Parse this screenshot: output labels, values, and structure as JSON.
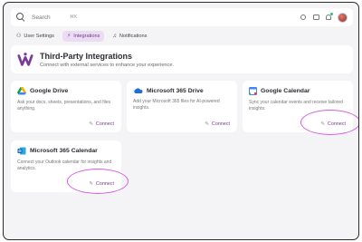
{
  "search": {
    "placeholder": "Search",
    "shortcut": "⌘K"
  },
  "tabs": [
    {
      "label": "User Settings"
    },
    {
      "label": "Integrations"
    },
    {
      "label": "Notifications"
    }
  ],
  "header": {
    "title": "Third-Party Integrations",
    "subtitle": "Connect with external services to enhance your experience."
  },
  "cards": [
    {
      "title": "Google Drive",
      "description": "Ask your docs, sheets, presentations, and files anything.",
      "button": "Connect"
    },
    {
      "title": "Microsoft 365 Drive",
      "description": "Add your Microsoft 365 files for AI-powered insights.",
      "button": "Connect"
    },
    {
      "title": "Google Calendar",
      "description": "Sync your calendar events and receive tailored insights.",
      "button": "Connect"
    },
    {
      "title": "Microsoft 365 Calendar",
      "description": "Connect your Outlook calendar for insights and analytics.",
      "button": "Connect"
    }
  ],
  "colors": {
    "accent": "#7b3a97",
    "highlight": "#d45ee0",
    "active_tab_bg": "#ecdcf3"
  }
}
